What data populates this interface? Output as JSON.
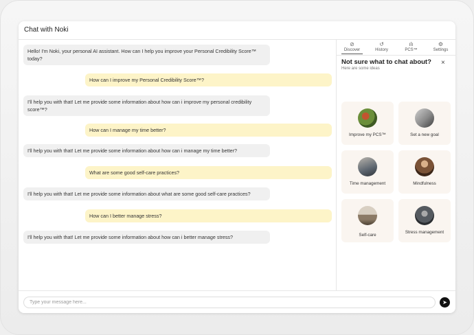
{
  "window": {
    "title": "Chat with Noki"
  },
  "messages": [
    {
      "role": "bot",
      "text": "Hello! I'm Noki, your personal AI assistant. How can I help you improve your Personal Credibility Score™ today?"
    },
    {
      "role": "user",
      "text": "How can I improve my Personal Credibility Score™?"
    },
    {
      "role": "bot",
      "text": "I'll help you with that! Let me provide some information about how can i improve my personal credibility score™?"
    },
    {
      "role": "user",
      "text": "How can I manage my time better?"
    },
    {
      "role": "bot",
      "text": "I'll help you with that! Let me provide some information about how can i manage my time better?"
    },
    {
      "role": "user",
      "text": "What are some good self-care practices?"
    },
    {
      "role": "bot",
      "text": "I'll help you with that! Let me provide some information about what are some good self-care practices?"
    },
    {
      "role": "user",
      "text": "How can I better manage stress?"
    },
    {
      "role": "bot",
      "text": "I'll help you with that! Let me provide some information about how can i better manage stress?"
    }
  ],
  "sidebar": {
    "tabs": [
      {
        "label": "Discover",
        "icon": "compass-icon",
        "glyph": "⊘"
      },
      {
        "label": "History",
        "icon": "history-icon",
        "glyph": "↺"
      },
      {
        "label": "PCS™",
        "icon": "bar-chart-icon",
        "glyph": "ılı"
      },
      {
        "label": "Settings",
        "icon": "gear-icon",
        "glyph": "⚙"
      }
    ],
    "active_tab": "Discover",
    "heading": "Not sure what to chat about?",
    "subheading": "Here are some ideas",
    "close_glyph": "×",
    "cards": [
      {
        "label": "Improve my PCS™",
        "icon": "food-bowl-image",
        "color": "#6b8e3a"
      },
      {
        "label": "Set a new goal",
        "icon": "goal-image",
        "color": "#8a8a8a"
      },
      {
        "label": "Time management",
        "icon": "workspace-image",
        "color": "#5d6670"
      },
      {
        "label": "Mindfulness",
        "icon": "mindfulness-image",
        "color": "#7a5236"
      },
      {
        "label": "Self-care",
        "icon": "yoga-image",
        "color": "#8b7a66"
      },
      {
        "label": "Stress management",
        "icon": "stress-image",
        "color": "#555a60"
      }
    ]
  },
  "composer": {
    "placeholder": "Type your message here...",
    "value": "",
    "send_icon": "send-icon",
    "send_glyph": "➤"
  },
  "colors": {
    "user_bubble": "#fdf4c8",
    "bot_bubble": "#f0f0f0",
    "card_bg": "#faf5f0",
    "send_button": "#111111"
  }
}
